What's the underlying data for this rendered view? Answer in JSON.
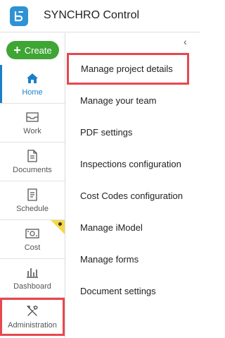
{
  "app": {
    "title": "SYNCHRO Control"
  },
  "sidebar": {
    "create_label": "Create",
    "items": [
      {
        "label": "Home",
        "icon": "home-icon",
        "active": true
      },
      {
        "label": "Work",
        "icon": "inbox-icon"
      },
      {
        "label": "Documents",
        "icon": "document-icon"
      },
      {
        "label": "Schedule",
        "icon": "schedule-icon"
      },
      {
        "label": "Cost",
        "icon": "cost-icon",
        "badge": true
      },
      {
        "label": "Dashboard",
        "icon": "chart-icon"
      },
      {
        "label": "Administration",
        "icon": "tools-icon"
      }
    ]
  },
  "menu": {
    "collapse_glyph": "‹",
    "items": [
      "Manage project details",
      "Manage your team",
      "PDF settings",
      "Inspections configuration",
      "Cost Codes configuration",
      "Manage iModel",
      "Manage forms",
      "Document settings"
    ]
  },
  "colors": {
    "accent": "#1b7fc8",
    "create": "#3fa535",
    "highlight": "#e8474f",
    "badge": "#f5d84a"
  }
}
